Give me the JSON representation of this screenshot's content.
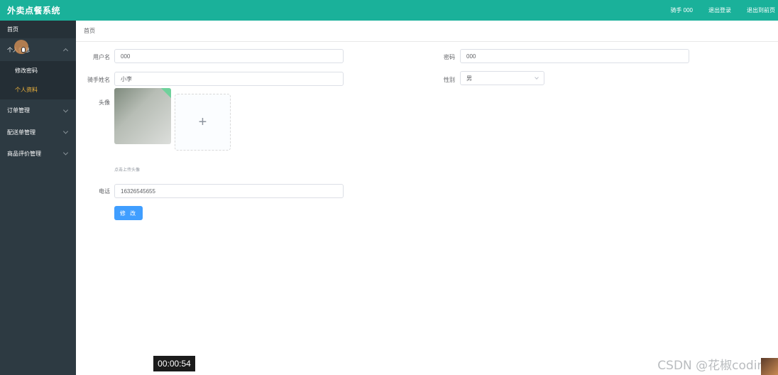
{
  "header": {
    "title": "外卖点餐系统",
    "user": "骑手 000",
    "logout": "退出登录",
    "exit_home": "退出到前页"
  },
  "sidebar": {
    "home": "首页",
    "personal": "个人信息",
    "change_password": "修改密码",
    "profile": "个人资料",
    "orders": "订单管理",
    "delivery": "配送单管理",
    "reviews": "商品评价管理"
  },
  "breadcrumb": "首页",
  "form": {
    "username_label": "用户名",
    "username_value": "000",
    "password_label": "密码",
    "password_value": "000",
    "rider_name_label": "骑手姓名",
    "rider_name_value": "小李",
    "gender_label": "性别",
    "gender_value": "男",
    "avatar_label": "头像",
    "upload_plus": "+",
    "upload_hint": "点击上传头像",
    "phone_label": "电话",
    "phone_value": "16326545655",
    "submit_label": "修 改"
  },
  "overlay": {
    "timer": "00:00:54",
    "watermark": "CSDN @花椒coding"
  },
  "colors": {
    "header": "#1ab19a",
    "sidebar": "#2d3a42",
    "active_menu": "#f5b83d",
    "primary_button": "#409eff"
  }
}
